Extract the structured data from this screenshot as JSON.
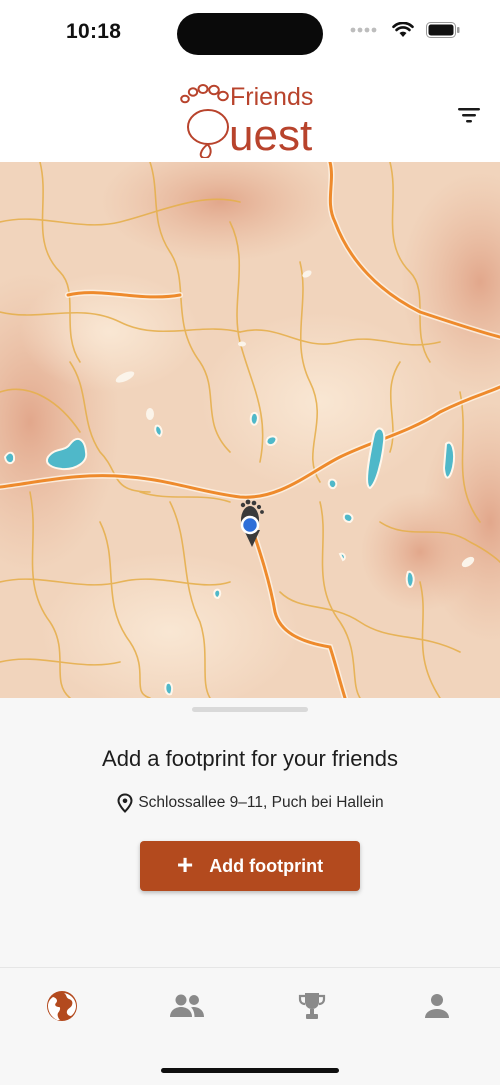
{
  "status_bar": {
    "time": "10:18"
  },
  "header": {
    "logo_text_top": "Friends",
    "logo_text_bottom": "uest",
    "filter_icon": "filter-icon"
  },
  "sheet": {
    "title": "Add a footprint for your friends",
    "address": "Schlossallee 9–11, Puch bei Hallein",
    "address_icon": "location-pin-icon",
    "add_button_label": "Add footprint",
    "add_button_icon": "plus-icon"
  },
  "tabs": [
    {
      "name": "map",
      "icon": "globe-icon",
      "active": true
    },
    {
      "name": "friends",
      "icon": "people-icon",
      "active": false
    },
    {
      "name": "achievements",
      "icon": "trophy-icon",
      "active": false
    },
    {
      "name": "profile",
      "icon": "person-icon",
      "active": false
    }
  ],
  "colors": {
    "accent": "#b34a1e",
    "tab_active": "#b34a1e",
    "tab_inactive": "#8a8a8a",
    "map_background": "#f1d4bc",
    "location_dot": "#2f6fd8"
  }
}
